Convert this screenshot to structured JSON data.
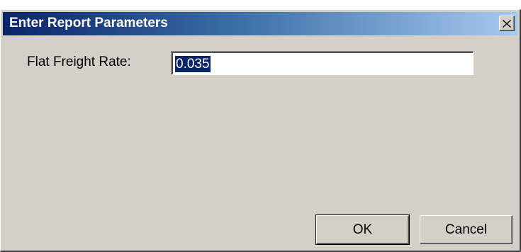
{
  "window": {
    "title": "Enter Report Parameters",
    "close_icon": "close-x-icon"
  },
  "form": {
    "label": "Flat Freight Rate:",
    "value": "0.035"
  },
  "buttons": {
    "ok_label": "OK",
    "cancel_label": "Cancel"
  },
  "colors": {
    "title_bar_start": "#0a246a",
    "title_bar_end": "#a6caf0",
    "dialog_background": "#d4d0c8",
    "selection_highlight": "#0a246a"
  }
}
